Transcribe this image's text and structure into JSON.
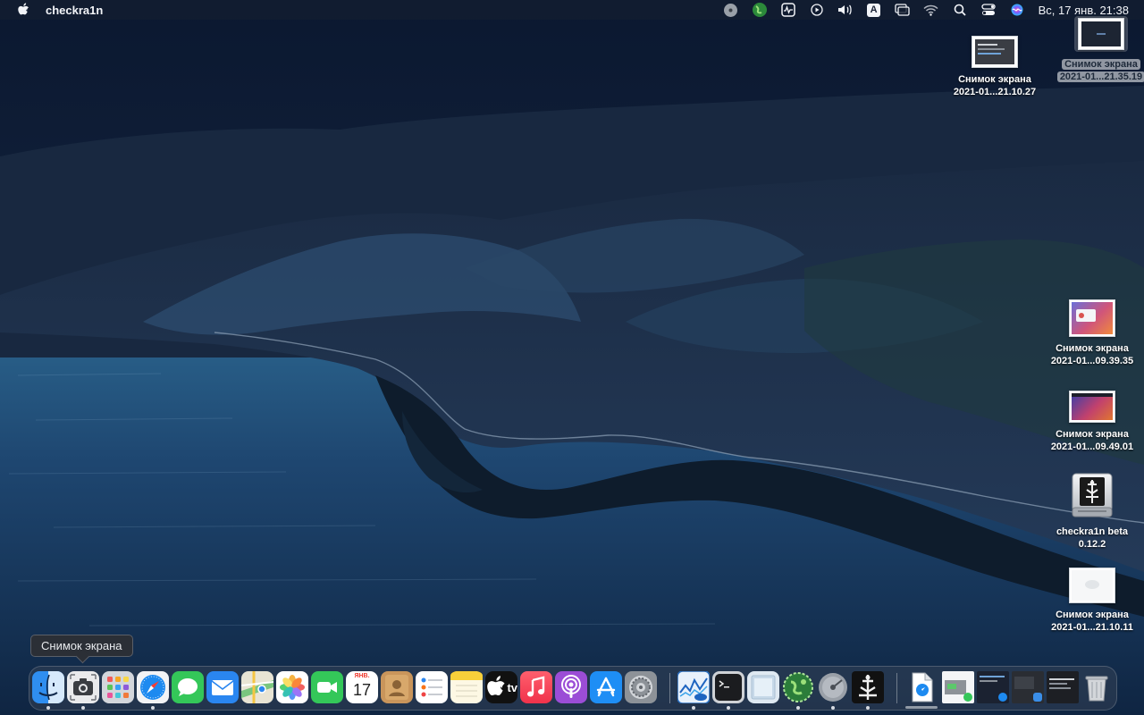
{
  "menubar": {
    "app_name": "checkra1n",
    "clock": "Вс, 17 янв.  21:38",
    "status_icons": [
      "disk-icon",
      "globe-status-icon",
      "activity-monitor-icon",
      "play-icon",
      "volume-icon",
      "input-source-icon",
      "screen-mirroring-icon",
      "wifi-icon",
      "spotlight-icon",
      "control-center-icon",
      "siri-icon"
    ],
    "input_source_letter": "A"
  },
  "desktop": {
    "icons": [
      {
        "name": "Снимок экрана",
        "line2": "2021-01...21.10.27"
      },
      {
        "name": "Снимок экрана",
        "line2": "2021-01...21.35.19"
      },
      {
        "name": "Снимок экрана",
        "line2": "2021-01...09.39.35"
      },
      {
        "name": "Снимок экрана",
        "line2": "2021-01...09.49.01"
      },
      {
        "name": "checkra1n beta",
        "line2": "0.12.2"
      },
      {
        "name": "Снимок экрана",
        "line2": "2021-01...21.10.11"
      }
    ]
  },
  "dock": {
    "tooltip": "Снимок экрана",
    "calendar": {
      "month": "ЯНВ.",
      "day": "17"
    },
    "tv_label": "tv",
    "items": [
      "finder-icon",
      "screenshot-icon",
      "launchpad-icon",
      "safari-icon",
      "messages-icon",
      "mail-icon",
      "maps-icon",
      "photos-icon",
      "facetime-icon",
      "calendar-icon",
      "contacts-icon",
      "reminders-icon",
      "notes-icon",
      "apple-tv-icon",
      "music-icon",
      "podcasts-icon",
      "app-store-icon",
      "system-preferences-icon",
      "intel-power-gadget-icon",
      "terminal-icon",
      "preview-icon",
      "globe-app-icon",
      "disk-utility-icon",
      "checkra1n-icon",
      "document-icon",
      "screenshot-thumb-1",
      "screenshot-thumb-2",
      "screenshot-thumb-3",
      "screenshot-thumb-4",
      "trash-icon"
    ]
  },
  "colors": {
    "menubar_bg": "#141e30",
    "sea": "#1b3a5c",
    "mountains": "#1d2e44"
  }
}
